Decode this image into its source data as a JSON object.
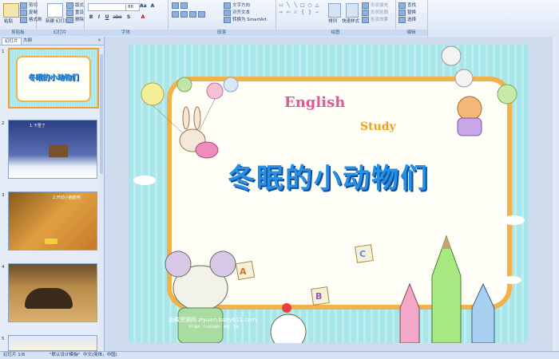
{
  "ribbon": {
    "clipboard": {
      "label": "剪贴板",
      "paste": "粘贴",
      "cut": "剪切",
      "copy": "复制",
      "format_painter": "格式刷"
    },
    "slides": {
      "label": "幻灯片",
      "new_slide": "新建\n幻灯片",
      "layout": "版式",
      "reset": "重设",
      "delete": "删除"
    },
    "font": {
      "label": "字体",
      "font_size": "88",
      "bold": "B",
      "italic": "I",
      "underline": "U",
      "strike": "abe",
      "shadow": "S",
      "aa": "Aa",
      "case": "A"
    },
    "paragraph": {
      "label": "段落",
      "text_direction": "文字方向",
      "align_text": "对齐文本",
      "convert_smartart": "转换为 SmartArt"
    },
    "drawing": {
      "label": "绘图",
      "arrange": "排列",
      "quick_styles": "快速样式",
      "shape_fill": "形状填充",
      "shape_outline": "形状轮廓",
      "shape_effects": "形状效果"
    },
    "editing": {
      "label": "编辑",
      "find": "查找",
      "replace": "替换",
      "select": "选择"
    }
  },
  "left_panel": {
    "tab_slides": "幻灯片",
    "tab_outline": "大纲",
    "close": "×",
    "thumbnails": [
      {
        "num": "1",
        "selected": true
      },
      {
        "num": "2",
        "selected": false,
        "text": "1.下雪了"
      },
      {
        "num": "3",
        "selected": false,
        "text": "2.开动小脑筋吧"
      },
      {
        "num": "4",
        "selected": false
      },
      {
        "num": "5",
        "selected": false
      }
    ]
  },
  "slide": {
    "english": "English",
    "study": "Study",
    "title": "冬眠的小动物们",
    "letter_a": "A",
    "letter_b": "B",
    "letter_c": "C",
    "watermark": "幼教资源网 ziyuan.baby611.com",
    "watermark2": "PPT课件 · FLASH课件 · 教案 · 试卷"
  },
  "status": {
    "slide_info": "幻灯片 1/8",
    "theme": "\"默认设计模板\"",
    "language": "中文(简体，中国)"
  },
  "colors": {
    "accent": "#2a8fe0",
    "frame": "#f3b14a",
    "slide_bg": "#a9e6ea"
  }
}
